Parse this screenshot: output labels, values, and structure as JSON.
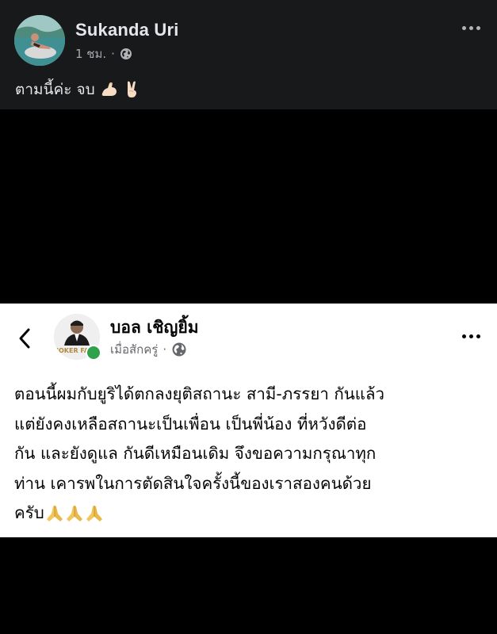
{
  "post": {
    "author": "Sukanda Uri",
    "time": "1 ชม.",
    "separator": "·",
    "audience_icon": "globe-icon",
    "caption": "ตามนี้ค่ะ จบ",
    "caption_emojis": [
      "flexed-biceps-emoji",
      "victory-hand-emoji"
    ]
  },
  "embedded_post": {
    "author": "บอล เชิญยิ้ม",
    "time": "เมื่อสักครู่",
    "separator": "·",
    "audience_icon": "globe-icon",
    "avatar_text": "JOKER FA",
    "online": true,
    "body_lines": [
      "ตอนนี้ผมกับยูริได้ตกลงยุติสถานะ สามี-ภรรยา กันแล้ว",
      "แต่ยังคงเหลือสถานะเป็นเพื่อน เป็นพี่น้อง ที่หวังดีต่อ",
      "กัน และยังดูแล กันดีเหมือนเดิม จึงขอความกรุณาทุก",
      "ท่าน เคารพในการตัดสินใจครั้งนี้ของเราสองคนด้วย",
      "ครับ"
    ],
    "trailing_emojis": [
      "folded-hands-emoji",
      "folded-hands-emoji",
      "folded-hands-emoji"
    ]
  },
  "colors": {
    "dark_background": "#18191a",
    "media_background": "#000000",
    "embed_background": "#ffffff",
    "online_green": "#31a24c"
  }
}
